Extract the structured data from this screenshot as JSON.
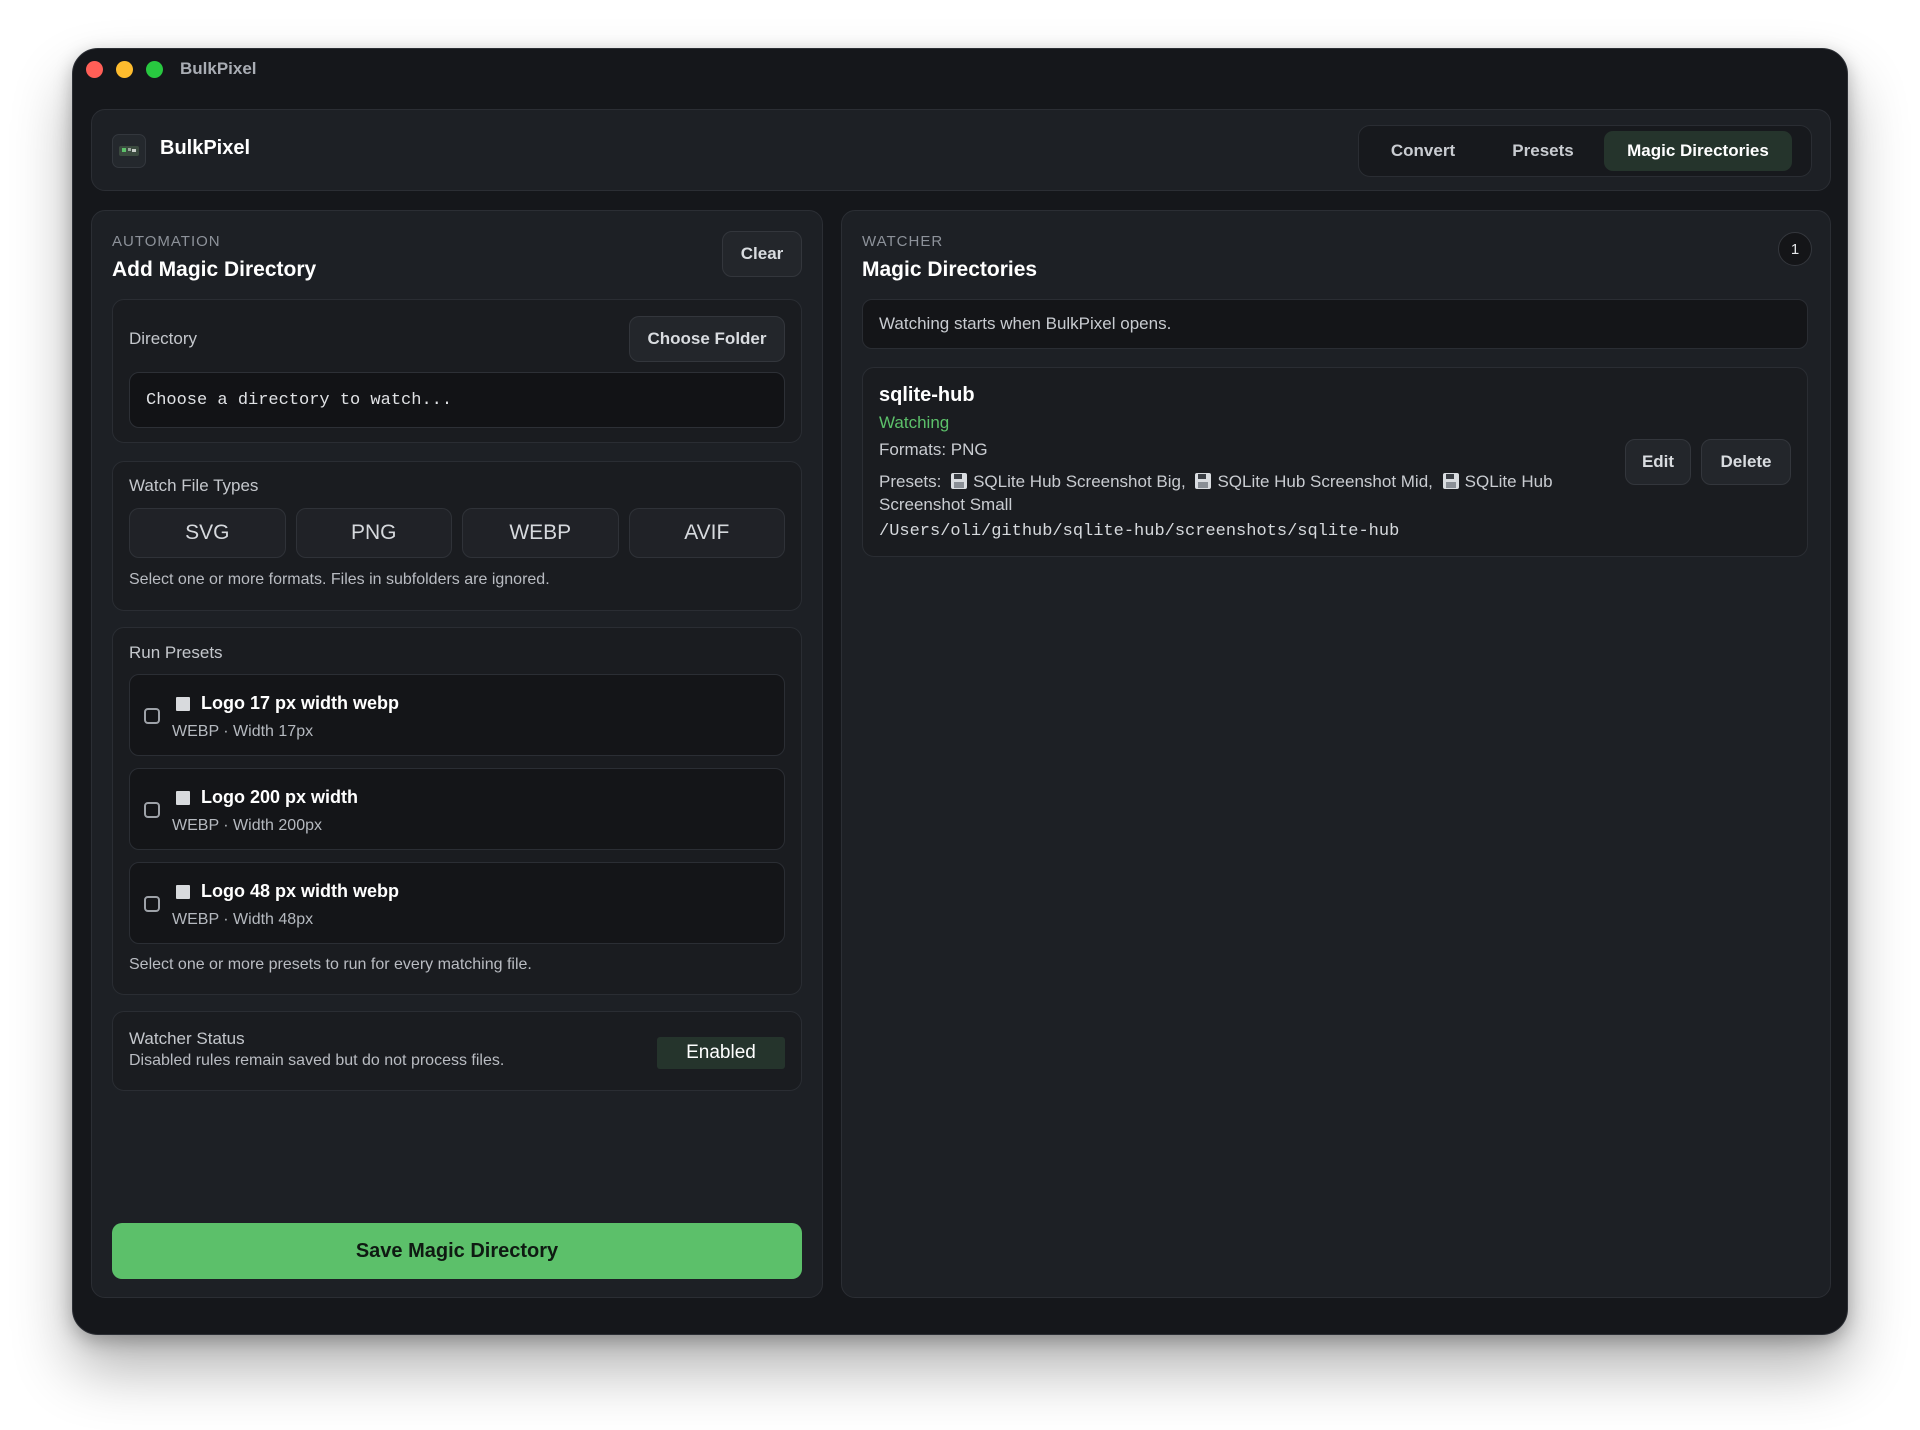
{
  "window": {
    "title": "BulkPixel"
  },
  "header": {
    "brand": "BulkPixel",
    "tabs": [
      {
        "label": "Convert",
        "active": false
      },
      {
        "label": "Presets",
        "active": false
      },
      {
        "label": "Magic Directories",
        "active": true
      }
    ]
  },
  "left": {
    "eyebrow": "AUTOMATION",
    "title": "Add Magic Directory",
    "clear_label": "Clear",
    "directory": {
      "label": "Directory",
      "choose_label": "Choose Folder",
      "placeholder": "Choose a directory to watch...",
      "value": ""
    },
    "file_types": {
      "label": "Watch File Types",
      "options": [
        "SVG",
        "PNG",
        "WEBP",
        "AVIF"
      ],
      "hint": "Select one or more formats. Files in subfolders are ignored."
    },
    "presets": {
      "label": "Run Presets",
      "items": [
        {
          "name": "Logo 17 px width webp",
          "meta": "WEBP · Width 17px",
          "checked": false
        },
        {
          "name": "Logo 200 px width",
          "meta": "WEBP · Width 200px",
          "checked": false
        },
        {
          "name": "Logo 48 px width webp",
          "meta": "WEBP · Width 48px",
          "checked": false
        }
      ],
      "hint": "Select one or more presets to run for every matching file."
    },
    "status": {
      "title": "Watcher Status",
      "description": "Disabled rules remain saved but do not process files.",
      "value": "Enabled"
    },
    "save_label": "Save Magic Directory"
  },
  "right": {
    "eyebrow": "WATCHER",
    "title": "Magic Directories",
    "count": "1",
    "info": "Watching starts when BulkPixel opens.",
    "directories": [
      {
        "name": "sqlite-hub",
        "status": "Watching",
        "formats": "Formats: PNG",
        "presets_prefix": "Presets:",
        "presets": [
          "SQLite Hub Screenshot Big,",
          "SQLite Hub Screenshot Mid,",
          "SQLite Hub Screenshot Small"
        ],
        "path": "/Users/oli/github/sqlite-hub/screenshots/sqlite-hub",
        "edit_label": "Edit",
        "delete_label": "Delete"
      }
    ]
  },
  "colors": {
    "accent": "#5cc06a",
    "background": "#15171b",
    "card": "#1d2025",
    "active_tab": "#25342c"
  }
}
